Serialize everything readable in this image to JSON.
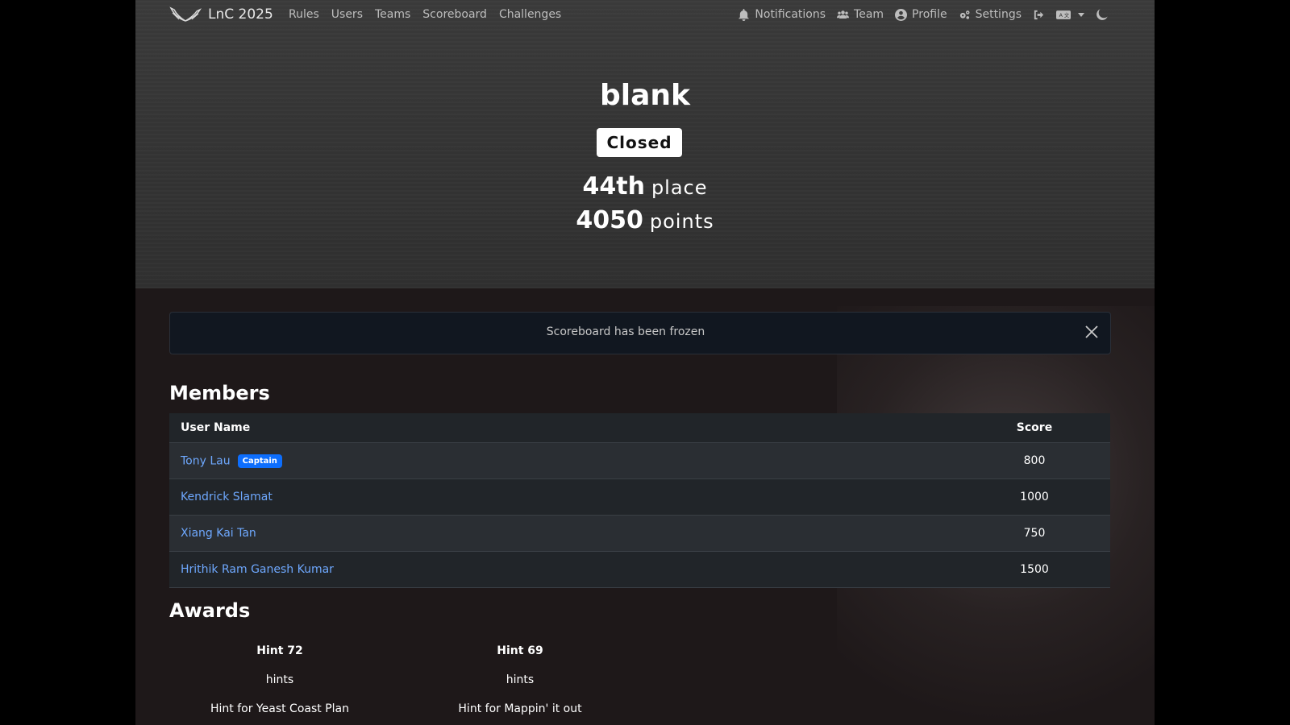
{
  "nav": {
    "brand": "LnC 2025",
    "left_links": [
      "Rules",
      "Users",
      "Teams",
      "Scoreboard",
      "Challenges"
    ],
    "notifications": "Notifications",
    "team": "Team",
    "profile": "Profile",
    "settings": "Settings"
  },
  "team": {
    "name": "blank",
    "status": "Closed",
    "place_value": "44th",
    "place_label": "place",
    "points_value": "4050",
    "points_label": "points"
  },
  "alert": {
    "message": "Scoreboard has been frozen"
  },
  "members": {
    "heading": "Members",
    "columns": {
      "user_name": "User Name",
      "score": "Score"
    },
    "rows": [
      {
        "name": "Tony Lau",
        "badge": "Captain",
        "score": "800"
      },
      {
        "name": "Kendrick Slamat",
        "score": "1000"
      },
      {
        "name": "Xiang Kai Tan",
        "score": "750"
      },
      {
        "name": "Hrithik Ram Ganesh Kumar",
        "score": "1500"
      }
    ]
  },
  "awards": {
    "heading": "Awards",
    "items": [
      {
        "name": "Hint 72",
        "category": "hints",
        "description": "Hint for Yeast Coast Plan"
      },
      {
        "name": "Hint 69",
        "category": "hints",
        "description": "Hint for Mappin' it out"
      }
    ]
  },
  "colors": {
    "link": "#6ea8fe",
    "captain_badge": "#0d6efd",
    "alert_bg": "#111720",
    "table_header_bg": "#212529"
  }
}
